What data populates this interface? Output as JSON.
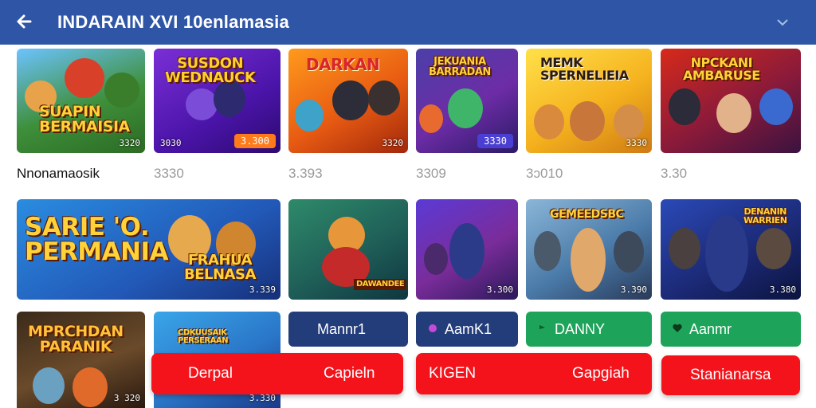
{
  "header": {
    "title": "INDARAIN XVI 10enlamasia",
    "back_icon": "arrow-left-icon",
    "menu_icon": "chevron-down-icon"
  },
  "row1": [
    {
      "art": "SUAPIN\nBERMAISIA",
      "tag": "3320"
    },
    {
      "art": "SUSDON\nWEDNAUCK",
      "tag": "3030",
      "pill": "3.300"
    },
    {
      "art": "DARKAN",
      "tag": "3320"
    },
    {
      "art": "JEKUANIA\nBARRADAN",
      "tag": "3330"
    },
    {
      "art": "MEMK\nSPERNELIEIA",
      "tag": "3330"
    },
    {
      "art": "NPCKANI\nAMBARUSE",
      "tag": ""
    }
  ],
  "labels": [
    "Nnonamaosik",
    "3330",
    "3.393",
    "3309",
    "3ɔ010",
    "3.30"
  ],
  "row2": [
    {
      "art": "SARIE 'O.\nPERMANIA",
      "art2": "FRAHUA\nBELNASA",
      "tag": "3.339"
    },
    {
      "art": "DAWANDEE",
      "tag": ""
    },
    {
      "art": "",
      "tag": "3.300"
    },
    {
      "art": "GEMEEDSBC",
      "tag": "3.390"
    },
    {
      "art": "DENANIN\nWARRIEN",
      "tag": "3.380"
    }
  ],
  "row3": [
    {
      "art": "MPRCHDAN\nPARANIK",
      "tag": "3 320"
    },
    {
      "art": "CDKUUSAIK\nPERSERAAN",
      "tag": "3.330"
    }
  ],
  "pill_buttons": [
    {
      "label": "Mannr1",
      "style": "navy"
    },
    {
      "label": "AamK1",
      "style": "navy"
    },
    {
      "label": "DANNY",
      "style": "green"
    },
    {
      "label": "Aanmr",
      "style": "green"
    }
  ],
  "red_buttons": {
    "b1_left": "Derpal",
    "b1_right": "Capieln",
    "b2_left": "KIGEN",
    "b2_right": "Gapgiah",
    "b3": "Stanianarsa"
  },
  "colors": {
    "header": "#2f56a6",
    "red": "#f5131b",
    "navy": "#233c7a",
    "green": "#1ea35a"
  }
}
